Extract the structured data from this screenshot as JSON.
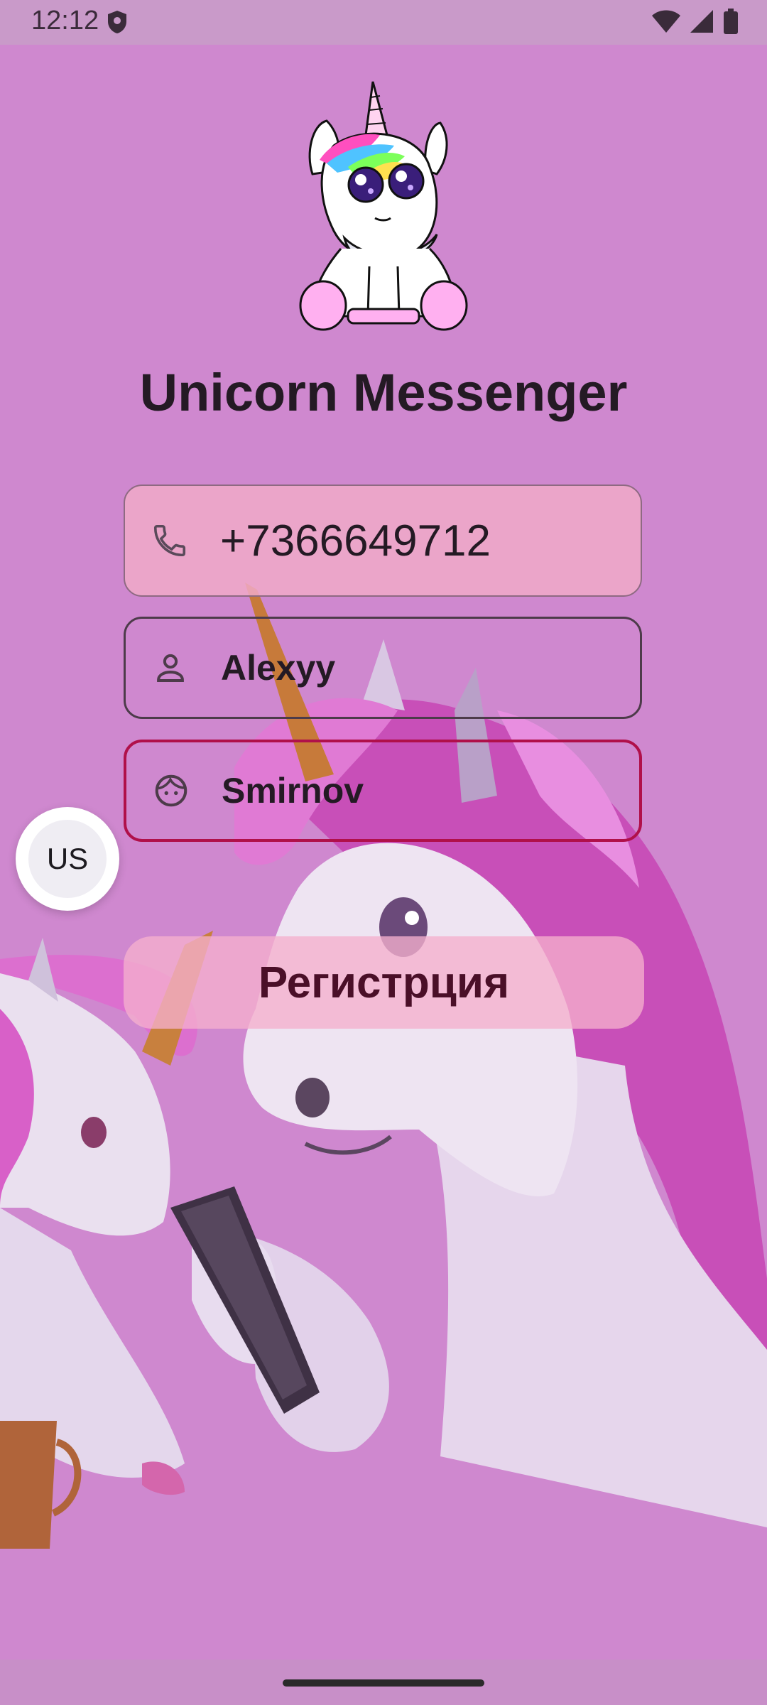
{
  "status_bar": {
    "time": "12:12",
    "icons": [
      "shield-icon",
      "wifi-icon",
      "signal-icon",
      "battery-icon"
    ]
  },
  "app": {
    "title": "Unicorn Messenger",
    "logo": "unicorn-logo"
  },
  "form": {
    "phone": {
      "value": "+7366649712",
      "icon": "phone-icon"
    },
    "first_name": {
      "value": "Alexyy",
      "icon": "person-icon"
    },
    "last_name": {
      "value": "Smirnov",
      "icon": "face-icon",
      "state": "focused"
    },
    "country_code": "US",
    "register_label": "Регистрция"
  },
  "colors": {
    "background": "#cf88cf",
    "accent_border": "#b0104a",
    "button_text": "#4a0f28",
    "title_text": "#241a24"
  }
}
